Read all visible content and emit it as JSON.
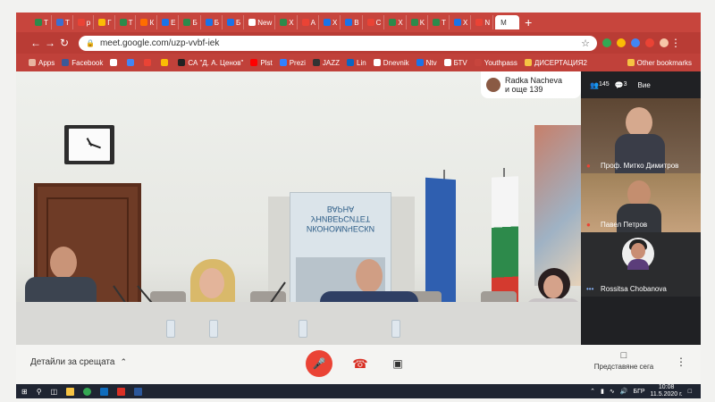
{
  "browser": {
    "tabs": [
      {
        "label": "T",
        "color": "#2d8a4b"
      },
      {
        "label": "T",
        "color": "#3b6fd1"
      },
      {
        "label": "p",
        "color": "#ea4335"
      },
      {
        "label": "Г",
        "color": "#fbbc05"
      },
      {
        "label": "T",
        "color": "#2d8a4b"
      },
      {
        "label": "К",
        "color": "#ff6d00"
      },
      {
        "label": "Е",
        "color": "#1a73e8"
      },
      {
        "label": "Б",
        "color": "#2d8a4b"
      },
      {
        "label": "Б",
        "color": "#1a73e8"
      },
      {
        "label": "Б",
        "color": "#1a73e8"
      },
      {
        "label": "New",
        "color": "#ffffff"
      },
      {
        "label": "X",
        "color": "#2d8a4b"
      },
      {
        "label": "A",
        "color": "#ea4335"
      },
      {
        "label": "X",
        "color": "#1a73e8"
      },
      {
        "label": "B",
        "color": "#1a73e8"
      },
      {
        "label": "C",
        "color": "#ea4335"
      },
      {
        "label": "X",
        "color": "#2d8a4b"
      },
      {
        "label": "K",
        "color": "#2d8a4b"
      },
      {
        "label": "T",
        "color": "#2d8a4b"
      },
      {
        "label": "X",
        "color": "#1a73e8"
      },
      {
        "label": "N",
        "color": "#ea4335"
      }
    ],
    "active_tab": "M",
    "new_tab": "+",
    "url": "meet.google.com/uzp-vvbf-iek",
    "bookmarks": [
      "Apps",
      "Facebook",
      "",
      "",
      "",
      "",
      "СА \"Д. А. Ценов\"",
      "Plst",
      "Prezi",
      "JAZZ",
      "Lin",
      "Dnevnik",
      "Ntv",
      "БТV",
      "Youthpass",
      "ДИСЕРТАЦИЯ2"
    ],
    "other_bookmarks": "Other bookmarks"
  },
  "meet": {
    "presenter_name": "Radka Nacheva",
    "presenter_more": "и още 139",
    "participants_count": "145",
    "chat_count": "3",
    "you_label": "Вие",
    "tiles": [
      {
        "name": "Проф. Митко Димитров",
        "muted": true
      },
      {
        "name": "Павел Петров",
        "muted": true
      },
      {
        "name": "Rossitsa Chobanova",
        "muted": false
      }
    ],
    "banner_title": "ИКОНОМИЧЕСКИ УНИВЕРСИТЕТ ВАРНА",
    "details_label": "Детайли за срещата",
    "present_label": "Представяне сега"
  },
  "taskbar": {
    "lang": "БГР",
    "time": "10:08",
    "date": "11.5.2020 г."
  },
  "colors": {
    "chrome_red": "#c7453d",
    "end_call_red": "#d93025",
    "mic_off_red": "#ea4335"
  }
}
